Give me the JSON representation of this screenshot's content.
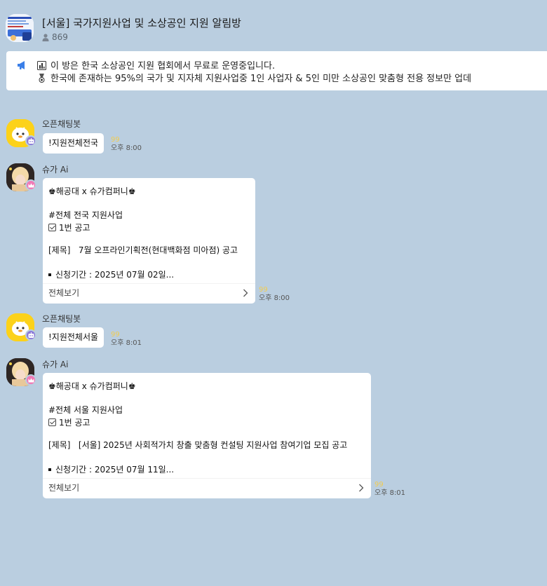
{
  "room": {
    "title": "[서울] 국가지원사업 및 소상공인 지원 알림방",
    "member_count": "869"
  },
  "notice": {
    "line1": "이 방은 한국 소상공인 지원 협회에서 무료로 운영중입니다.",
    "line2": "한국에 존재하는 95%의 국가 및 지자체 지원사업중 1인 사업자 & 5인 미만 소상공인 맞춤형 전용 정보만 업데"
  },
  "messages": [
    {
      "sender": "오픈채팅봇",
      "text": "!지원전체전국",
      "quote": "99",
      "time": "오후 8:00"
    },
    {
      "sender": "슈가 Ai",
      "card": {
        "brand": "해공대 x 슈가컴퍼니",
        "category": "#전체 전국 지원사업",
        "count": "1번 공고",
        "title_label": "[제목]",
        "title": "7월 오프라인기획전(현대백화점 미아점) 공고",
        "period": "신청기간 : 2025년 07월 02일...",
        "more": "전체보기"
      },
      "quote": "99",
      "time": "오후 8:00"
    },
    {
      "sender": "오픈채팅봇",
      "text": "!지원전체서울",
      "quote": "99",
      "time": "오후 8:01"
    },
    {
      "sender": "슈가 Ai",
      "card": {
        "brand": "해공대 x 슈가컴퍼니",
        "category": "#전체 서울 지원사업",
        "count": "1번 공고",
        "title_label": "[제목]",
        "title": "[서울] 2025년 사회적가치 창출 맞춤형 컨설팅 지원사업 참여기업 모집 공고",
        "period": "신청기간 : 2025년 07월 11일...",
        "more": "전체보기"
      },
      "quote": "99",
      "time": "오후 8:01"
    }
  ],
  "icons": {
    "crown": "♚",
    "megaphone": "megaphone-icon",
    "bot_badge": "robot-icon",
    "king_badge": "crown-icon"
  },
  "colors": {
    "background": "#bacee0",
    "bot_avatar": "#fcd21a",
    "bot_badge": "#8d7bd8",
    "ai_badge": "#f07ab6",
    "quote": "#f1cc51",
    "notice_icon": "#3a7fe8"
  }
}
